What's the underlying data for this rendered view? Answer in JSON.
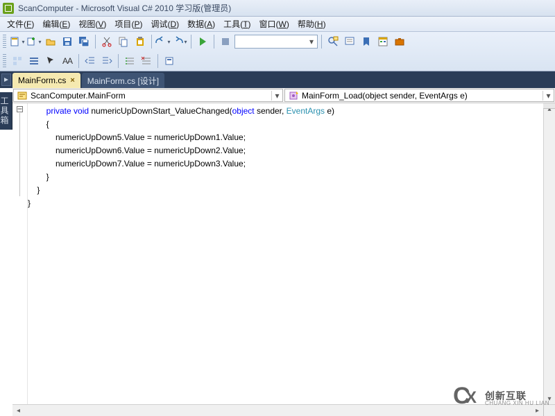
{
  "window": {
    "title": "ScanComputer - Microsoft Visual C# 2010 学习版(管理员)"
  },
  "menu": [
    {
      "label": "文件",
      "mn": "F"
    },
    {
      "label": "编辑",
      "mn": "E"
    },
    {
      "label": "视图",
      "mn": "V"
    },
    {
      "label": "项目",
      "mn": "P"
    },
    {
      "label": "调试",
      "mn": "D"
    },
    {
      "label": "数据",
      "mn": "A"
    },
    {
      "label": "工具",
      "mn": "T"
    },
    {
      "label": "窗口",
      "mn": "W"
    },
    {
      "label": "帮助",
      "mn": "H"
    }
  ],
  "tabs": {
    "active": {
      "label": "MainForm.cs"
    },
    "inactive": {
      "label": "MainForm.cs [设计]"
    }
  },
  "side_tab": {
    "label": "工具箱"
  },
  "nav": {
    "class": "ScanComputer.MainForm",
    "member": "MainForm_Load(object sender, EventArgs e)"
  },
  "code": {
    "l1_a": "        private void",
    "l1_b": " numericUpDownStart_ValueChanged(",
    "l1_c": "object",
    "l1_d": " sender, ",
    "l1_e": "EventArgs",
    "l1_f": " e)",
    "l2": "        {",
    "l3": "            numericUpDown5.Value = numericUpDown1.Value;",
    "l4": "            numericUpDown6.Value = numericUpDown2.Value;",
    "l5": "            numericUpDown7.Value = numericUpDown3.Value;",
    "l6": "        }",
    "l7": "    }",
    "l8": "}"
  },
  "fold": {
    "glyph": "−"
  },
  "watermark": {
    "cn": "创新互联",
    "en": "CHUANG XIN HU LIAN"
  },
  "combo_placeholder": ""
}
